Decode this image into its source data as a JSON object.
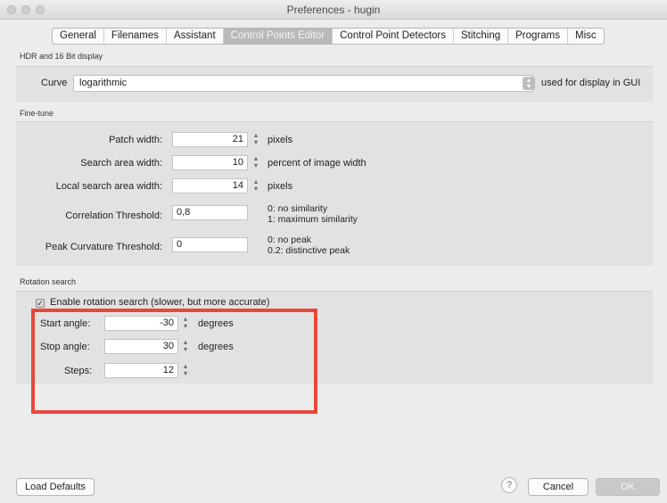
{
  "window": {
    "title": "Preferences - hugin"
  },
  "tabs": [
    {
      "label": "General"
    },
    {
      "label": "Filenames"
    },
    {
      "label": "Assistant"
    },
    {
      "label": "Control Points Editor",
      "active": true
    },
    {
      "label": "Control Point Detectors"
    },
    {
      "label": "Stitching"
    },
    {
      "label": "Programs"
    },
    {
      "label": "Misc"
    }
  ],
  "hdr": {
    "title": "HDR and 16 Bit display",
    "curve_label": "Curve",
    "curve_value": "logarithmic",
    "curve_hint": "used for display in GUI"
  },
  "finetune": {
    "title": "Fine-tune",
    "patch_width": {
      "label": "Patch width:",
      "value": "21",
      "unit": "pixels"
    },
    "search_area_width": {
      "label": "Search area width:",
      "value": "10",
      "unit": "percent of image width"
    },
    "local_search_area_width": {
      "label": "Local search area width:",
      "value": "14",
      "unit": "pixels"
    },
    "correlation_threshold": {
      "label": "Correlation Threshold:",
      "value": "0,8",
      "hint_line1": "0: no similarity",
      "hint_line2": "1: maximum similarity"
    },
    "peak_curvature_threshold": {
      "label": "Peak Curvature Threshold:",
      "value": "0",
      "hint_line1": "0: no peak",
      "hint_line2": "0.2: distinctive peak"
    }
  },
  "rotation": {
    "title": "Rotation search",
    "enable_label": "Enable rotation search (slower, but more accurate)",
    "enable_checked": true,
    "start_angle": {
      "label": "Start angle:",
      "value": "-30",
      "unit": "degrees"
    },
    "stop_angle": {
      "label": "Stop angle:",
      "value": "30",
      "unit": "degrees"
    },
    "steps": {
      "label": "Steps:",
      "value": "12"
    }
  },
  "footer": {
    "load_defaults": "Load Defaults",
    "help": "?",
    "cancel": "Cancel",
    "ok": "OK"
  },
  "icons": {
    "spin_up": "spin-up-icon",
    "spin_down": "spin-down-icon",
    "combo_arrow": "combo-arrows-icon",
    "checkbox": "checkbox-icon"
  },
  "colors": {
    "highlight_box": "#e8473b",
    "active_tab": "#b9b9b9"
  }
}
